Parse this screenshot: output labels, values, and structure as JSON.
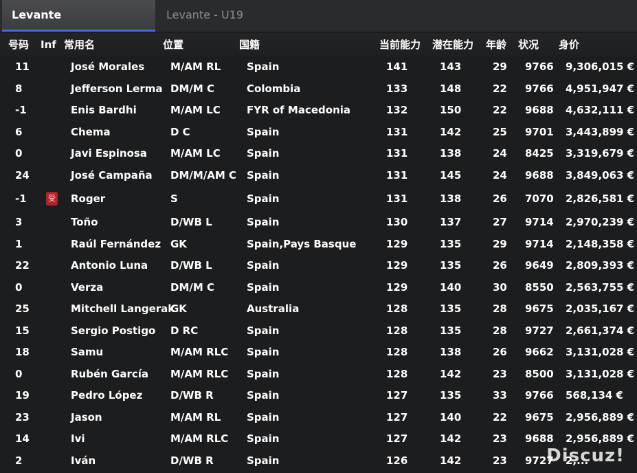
{
  "tabs": [
    {
      "label": "Levante",
      "active": true
    },
    {
      "label": "Levante - U19",
      "active": false
    }
  ],
  "columns": {
    "num": "号码",
    "inf": "Inf",
    "name": "常用名",
    "pos": "位置",
    "nat": "国籍",
    "ca": "当前能力",
    "pa": "潜在能力",
    "age": "年龄",
    "cond": "状况",
    "value": "身价"
  },
  "players": [
    {
      "num": "11",
      "inf": "",
      "name": "José Morales",
      "pos": "M/AM RL",
      "nat": "Spain",
      "ca": "141",
      "pa": "143",
      "age": "29",
      "cond": "9766",
      "value": "9,306,015 €"
    },
    {
      "num": "8",
      "inf": "",
      "name": "Jefferson Lerma",
      "pos": "DM/M C",
      "nat": "Colombia",
      "ca": "133",
      "pa": "148",
      "age": "22",
      "cond": "9766",
      "value": "4,951,947 €"
    },
    {
      "num": "-1",
      "inf": "",
      "name": "Enis Bardhi",
      "pos": "M/AM LC",
      "nat": "FYR of Macedonia",
      "ca": "132",
      "pa": "150",
      "age": "22",
      "cond": "9688",
      "value": "4,632,111 €"
    },
    {
      "num": "6",
      "inf": "",
      "name": "Chema",
      "pos": "D C",
      "nat": "Spain",
      "ca": "131",
      "pa": "142",
      "age": "25",
      "cond": "9701",
      "value": "3,443,899 €"
    },
    {
      "num": "0",
      "inf": "",
      "name": "Javi Espinosa",
      "pos": "M/AM LC",
      "nat": "Spain",
      "ca": "131",
      "pa": "138",
      "age": "24",
      "cond": "8425",
      "value": "3,319,679 €"
    },
    {
      "num": "24",
      "inf": "",
      "name": "José Campaña",
      "pos": "DM/M/AM C",
      "nat": "Spain",
      "ca": "131",
      "pa": "145",
      "age": "24",
      "cond": "9688",
      "value": "3,849,063 €"
    },
    {
      "num": "-1",
      "inf": "受",
      "name": "Roger",
      "pos": "S",
      "nat": "Spain",
      "ca": "131",
      "pa": "138",
      "age": "26",
      "cond": "7070",
      "value": "2,826,581 €"
    },
    {
      "num": "3",
      "inf": "",
      "name": "Toño",
      "pos": "D/WB L",
      "nat": "Spain",
      "ca": "130",
      "pa": "137",
      "age": "27",
      "cond": "9714",
      "value": "2,970,239 €"
    },
    {
      "num": "1",
      "inf": "",
      "name": "Raúl Fernández",
      "pos": "GK",
      "nat": "Spain,Pays Basque",
      "ca": "129",
      "pa": "135",
      "age": "29",
      "cond": "9714",
      "value": "2,148,358 €"
    },
    {
      "num": "22",
      "inf": "",
      "name": "Antonio Luna",
      "pos": "D/WB L",
      "nat": "Spain",
      "ca": "129",
      "pa": "135",
      "age": "26",
      "cond": "9649",
      "value": "2,809,393 €"
    },
    {
      "num": "0",
      "inf": "",
      "name": "Verza",
      "pos": "DM/M C",
      "nat": "Spain",
      "ca": "129",
      "pa": "140",
      "age": "30",
      "cond": "8550",
      "value": "2,563,755 €"
    },
    {
      "num": "25",
      "inf": "",
      "name": "Mitchell Langerak",
      "pos": "GK",
      "nat": "Australia",
      "ca": "128",
      "pa": "135",
      "age": "28",
      "cond": "9675",
      "value": "2,035,167 €"
    },
    {
      "num": "15",
      "inf": "",
      "name": "Sergio Postigo",
      "pos": "D RC",
      "nat": "Spain",
      "ca": "128",
      "pa": "135",
      "age": "28",
      "cond": "9727",
      "value": "2,661,374 €"
    },
    {
      "num": "18",
      "inf": "",
      "name": "Samu",
      "pos": "M/AM RLC",
      "nat": "Spain",
      "ca": "128",
      "pa": "138",
      "age": "26",
      "cond": "9662",
      "value": "3,131,028 €"
    },
    {
      "num": "0",
      "inf": "",
      "name": "Rubén García",
      "pos": "M/AM RLC",
      "nat": "Spain",
      "ca": "128",
      "pa": "142",
      "age": "23",
      "cond": "8500",
      "value": "3,131,028 €"
    },
    {
      "num": "19",
      "inf": "",
      "name": "Pedro López",
      "pos": "D/WB R",
      "nat": "Spain",
      "ca": "127",
      "pa": "135",
      "age": "33",
      "cond": "9766",
      "value": "568,134 €"
    },
    {
      "num": "23",
      "inf": "",
      "name": "Jason",
      "pos": "M/AM RL",
      "nat": "Spain",
      "ca": "127",
      "pa": "140",
      "age": "22",
      "cond": "9675",
      "value": "2,956,889 €"
    },
    {
      "num": "14",
      "inf": "",
      "name": "Ivi",
      "pos": "M/AM RLC",
      "nat": "Spain",
      "ca": "127",
      "pa": "142",
      "age": "23",
      "cond": "9688",
      "value": "2,956,889 €"
    },
    {
      "num": "2",
      "inf": "",
      "name": "Iván",
      "pos": "D/WB R",
      "nat": "Spain",
      "ca": "126",
      "pa": "142",
      "age": "23",
      "cond": "9727",
      "value": "2,..."
    }
  ],
  "watermark": "Discuz!"
}
